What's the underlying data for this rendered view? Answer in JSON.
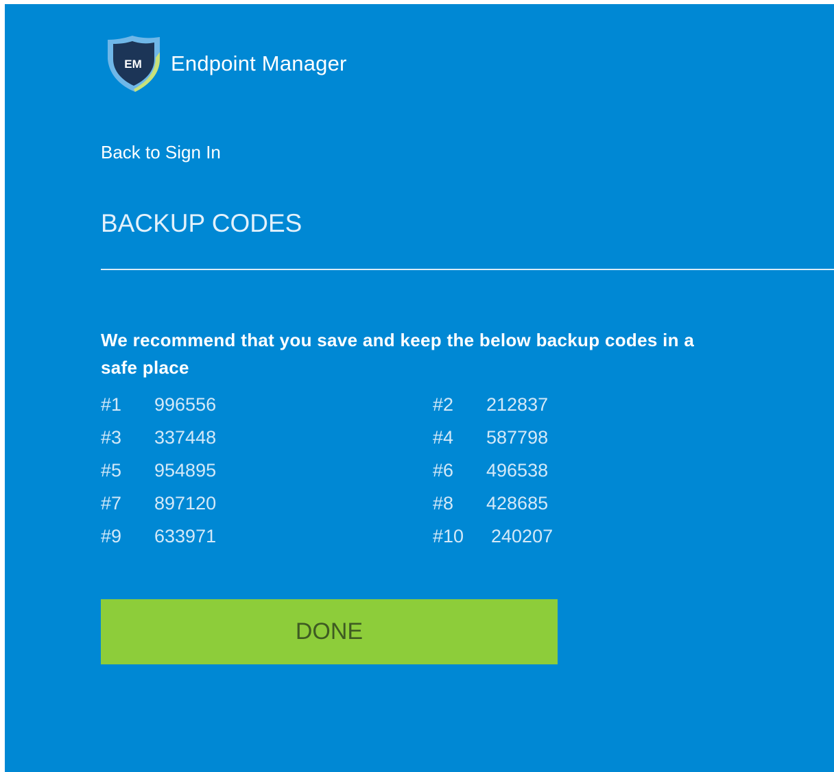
{
  "brand": {
    "logo_text": "EM",
    "name": "Endpoint Manager"
  },
  "nav": {
    "back_label": "Back to Sign In"
  },
  "page": {
    "title": "BACKUP CODES",
    "instructions": "We recommend that you save and keep the below backup codes in a safe place"
  },
  "codes": [
    {
      "label": "#1",
      "value": "996556"
    },
    {
      "label": "#2",
      "value": "212837"
    },
    {
      "label": "#3",
      "value": "337448"
    },
    {
      "label": "#4",
      "value": "587798"
    },
    {
      "label": "#5",
      "value": "954895"
    },
    {
      "label": "#6",
      "value": "496538"
    },
    {
      "label": "#7",
      "value": "897120"
    },
    {
      "label": "#8",
      "value": "428685"
    },
    {
      "label": "#9",
      "value": "633971"
    },
    {
      "label": "#10",
      "value": "240207"
    }
  ],
  "actions": {
    "done_label": "DONE"
  },
  "colors": {
    "background": "#0088d4",
    "button": "#8dcd3a",
    "button_text": "#3e5b22",
    "code_text": "#d3e9f8"
  }
}
